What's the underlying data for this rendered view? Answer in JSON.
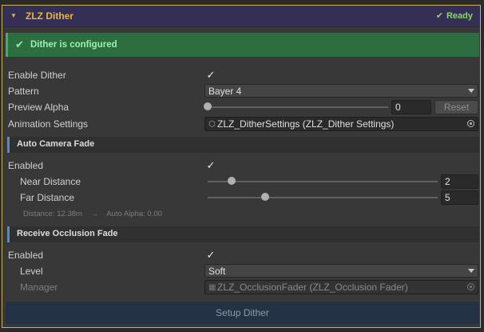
{
  "header": {
    "title": "ZLZ Dither",
    "status": "Ready"
  },
  "banner": {
    "text": "Dither is configured"
  },
  "enable_dither": {
    "label": "Enable Dither",
    "checked": true
  },
  "pattern": {
    "label": "Pattern",
    "value": "Bayer 4"
  },
  "preview_alpha": {
    "label": "Preview Alpha",
    "value": "0",
    "fraction": 0.0,
    "reset_label": "Reset"
  },
  "animation_settings": {
    "label": "Animation Settings",
    "value": "ZLZ_DitherSettings (ZLZ_Dither Settings)"
  },
  "auto_camera_fade": {
    "title": "Auto Camera Fade",
    "enabled_label": "Enabled",
    "enabled": true,
    "near": {
      "label": "Near Distance",
      "value": "2"
    },
    "far": {
      "label": "Far Distance",
      "value": "5"
    },
    "info_distance": "Distance: 12.38m",
    "info_arrow": "→",
    "info_alpha": "Auto Alpha: 0.00"
  },
  "receive_occlusion_fade": {
    "title": "Receive Occlusion Fade",
    "enabled_label": "Enabled",
    "enabled": true,
    "level": {
      "label": "Level",
      "value": "Soft"
    },
    "manager": {
      "label": "Manager",
      "value": "ZLZ_OcclusionFader (ZLZ_Occlusion Fader)"
    }
  },
  "setup_button": "Setup Dither",
  "colors": {
    "accent_border": "#c9b35c",
    "success": "#2c6e3f",
    "section_bar": "#4c8ec9",
    "title": "#e9b43f"
  }
}
